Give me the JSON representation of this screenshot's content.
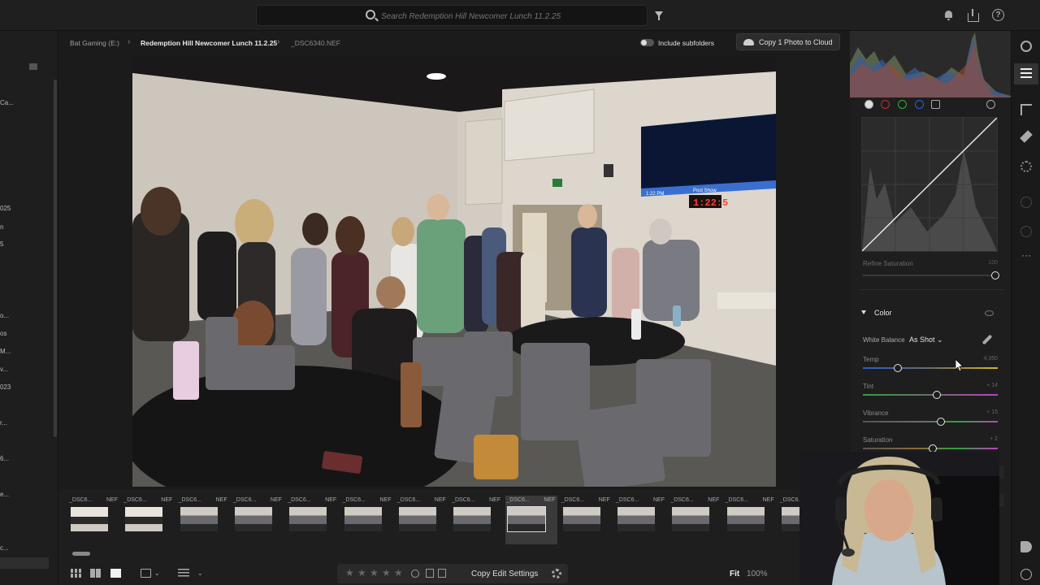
{
  "search": {
    "placeholder": "Search Redemption Hill Newcomer Lunch 11.2.25"
  },
  "left_panel": {
    "items": [
      "Ca...",
      "025",
      "n",
      "5",
      "o...",
      "os",
      "M...",
      "v...",
      "023",
      "r...",
      "6...",
      "e...",
      "c..."
    ]
  },
  "breadcrumb": {
    "drive": "Bat Gaming  (E:)",
    "album": "Redemption Hill Newcomer Lunch 11.2.25",
    "file": "_DSC6340.NEF",
    "separator": "›",
    "subfolders_label": "Include subfolders",
    "cloud_button": "Copy 1 Photo to Cloud"
  },
  "photo": {
    "tv_bar_left": "1:22 PM",
    "tv_bar_right": "Post Show",
    "timer": "1:22:5"
  },
  "filmstrip": {
    "thumbs": [
      {
        "name": "_DSC6...",
        "type": "NEF"
      },
      {
        "name": "_DSC6...",
        "type": "NEF"
      },
      {
        "name": "_DSC6...",
        "type": "NEF"
      },
      {
        "name": "_DSC6...",
        "type": "NEF"
      },
      {
        "name": "_DSC6...",
        "type": "NEF"
      },
      {
        "name": "_DSC6...",
        "type": "NEF"
      },
      {
        "name": "_DSC6...",
        "type": "NEF"
      },
      {
        "name": "_DSC6...",
        "type": "NEF"
      },
      {
        "name": "_DSC6...",
        "type": "NEF"
      },
      {
        "name": "_DSC6...",
        "type": "NEF"
      },
      {
        "name": "_DSC6...",
        "type": "NEF"
      },
      {
        "name": "_DSC6...",
        "type": "NEF"
      },
      {
        "name": "_DSC6...",
        "type": "NEF"
      },
      {
        "name": "_DSC6...",
        "type": "NEF"
      },
      {
        "name": "_DSC6...",
        "type": "NEF"
      }
    ],
    "selected_index": 8
  },
  "bottombar": {
    "stars": [
      "★",
      "★",
      "★",
      "★",
      "★"
    ],
    "copy_edit_settings": "Copy Edit Settings",
    "fit": "Fit",
    "zoom": "100%",
    "chevron": "⌄"
  },
  "curve": {
    "refine_saturation_label": "Refine Saturation",
    "refine_saturation_value": "100"
  },
  "color_panel": {
    "title": "Color",
    "white_balance_label": "White Balance",
    "white_balance_value": "As Shot ⌄",
    "sliders": [
      {
        "label": "Temp",
        "value": "4,350",
        "level": 0.26
      },
      {
        "label": "Tint",
        "value": "+ 14",
        "level": 0.55
      },
      {
        "label": "Vibrance",
        "value": "+ 15",
        "level": 0.58
      },
      {
        "label": "Saturation",
        "value": "+ 2",
        "level": 0.52
      }
    ]
  },
  "colors": {
    "accent": "#2f7fd8",
    "panel_bg": "#1e1e1e"
  }
}
